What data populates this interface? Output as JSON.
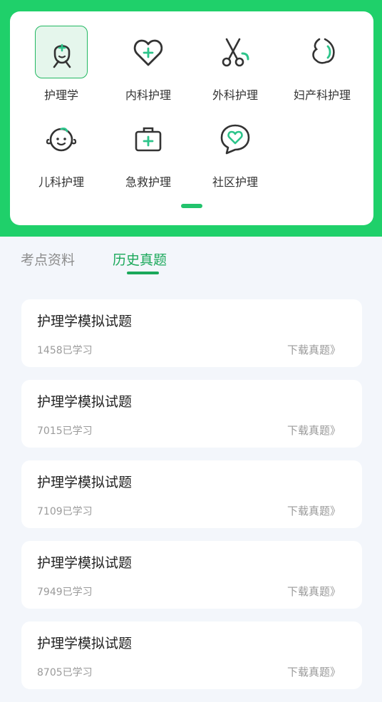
{
  "categories": [
    {
      "label": "护理学",
      "icon": "nurse-icon",
      "active": true
    },
    {
      "label": "内科护理",
      "icon": "heart-plus-icon",
      "active": false
    },
    {
      "label": "外科护理",
      "icon": "scissors-icon",
      "active": false
    },
    {
      "label": "妇产科护理",
      "icon": "pregnancy-icon",
      "active": false
    },
    {
      "label": "儿科护理",
      "icon": "baby-face-icon",
      "active": false
    },
    {
      "label": "急救护理",
      "icon": "first-aid-kit-icon",
      "active": false
    },
    {
      "label": "社区护理",
      "icon": "chat-heart-icon",
      "active": false
    }
  ],
  "tabs": [
    {
      "label": "考点资料",
      "active": false
    },
    {
      "label": "历史真题",
      "active": true
    }
  ],
  "papers": [
    {
      "title": "护理学模拟试题",
      "count": "1458已学习",
      "link": "下载真题》"
    },
    {
      "title": "护理学模拟试题",
      "count": "7015已学习",
      "link": "下载真题》"
    },
    {
      "title": "护理学模拟试题",
      "count": "7109已学习",
      "link": "下载真题》"
    },
    {
      "title": "护理学模拟试题",
      "count": "7949已学习",
      "link": "下载真题》"
    },
    {
      "title": "护理学模拟试题",
      "count": "8705已学习",
      "link": "下载真题》"
    }
  ],
  "colors": {
    "brand_green": "#1fd06a",
    "accent_green": "#1aa85a",
    "icon_dark": "#333333",
    "icon_accent": "#2cc48a"
  }
}
